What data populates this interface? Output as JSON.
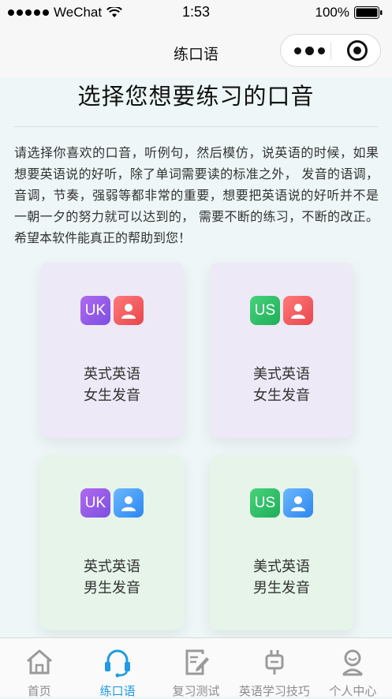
{
  "status_bar": {
    "carrier": "WeChat",
    "time": "1:53",
    "battery": "100%"
  },
  "nav": {
    "title": "练口语"
  },
  "page": {
    "title": "选择您想要练习的口音",
    "intro": "请选择你喜欢的口音，听例句，然后模仿，说英语的时候，如果想要英语说的好听，除了单词需要读的标准之外， 发音的语调，音调，节奏，强弱等都非常的重要，想要把英语说的好听并不是一朝一夕的努力就可以达到的， 需要不断的练习，不断的改正。希望本软件能真正的帮助到您！"
  },
  "cards": [
    {
      "flag": "UK",
      "line1": "英式英语",
      "line2": "女生发音",
      "person_color": "#e8454c"
    },
    {
      "flag": "US",
      "line1": "美式英语",
      "line2": "女生发音",
      "person_color": "#e8454c"
    },
    {
      "flag": "UK",
      "line1": "英式英语",
      "line2": "男生发音",
      "person_color": "#2b86f0"
    },
    {
      "flag": "US",
      "line1": "美式英语",
      "line2": "男生发音",
      "person_color": "#2b86f0"
    }
  ],
  "tabs": [
    {
      "label": "首页",
      "icon": "home-icon",
      "active": false
    },
    {
      "label": "练口语",
      "icon": "headset-icon",
      "active": true
    },
    {
      "label": "复习测试",
      "icon": "edit-icon",
      "active": false
    },
    {
      "label": "英语学习技巧",
      "icon": "plug-icon",
      "active": false
    },
    {
      "label": "个人中心",
      "icon": "user-icon",
      "active": false
    }
  ],
  "colors": {
    "accent": "#1e9be3",
    "inactive": "#8d8d8d"
  }
}
